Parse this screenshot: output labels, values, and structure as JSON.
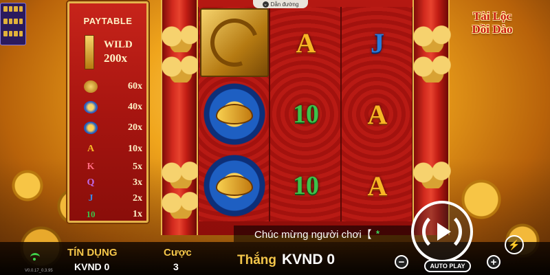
{
  "header": {
    "guide_label": "Dẫn đường"
  },
  "logo": {
    "line1": "Tài Lộc",
    "line2": "Dồi Dào"
  },
  "paytable": {
    "title": "PAYTABLE",
    "wild_label": "WILD",
    "wild_value": "200x",
    "rows": [
      {
        "symbol": "dragon-icon",
        "value": "60x"
      },
      {
        "symbol": "phoenix-icon",
        "value": "40x"
      },
      {
        "symbol": "koi-icon",
        "value": "20x"
      },
      {
        "symbol": "A",
        "value": "10x"
      },
      {
        "symbol": "K",
        "value": "5x"
      },
      {
        "symbol": "Q",
        "value": "3x"
      },
      {
        "symbol": "J",
        "value": "2x"
      },
      {
        "symbol": "10",
        "value": "1x"
      }
    ]
  },
  "reels": [
    [
      "wild-dragon",
      "koi",
      "koi"
    ],
    [
      "A",
      "10",
      "10"
    ],
    [
      "J",
      "A",
      "A"
    ]
  ],
  "marquee": {
    "text": "Chúc mừng người chơi【",
    "star": "*"
  },
  "bottom": {
    "credit_label": "TÍN DỤNG",
    "credit_value": "KVND 0",
    "bet_label": "Cược",
    "bet_value": "3",
    "win_label": "Thắng",
    "win_value": "KVND 0",
    "auto_play_label": "AUTO PLAY",
    "minus_label": "−",
    "plus_label": "+",
    "version": "V0.0.17_0.3.95"
  },
  "colors": {
    "accent_gold": "#f4c64a",
    "frame_red": "#b51812",
    "wifi_green": "#3fd24a"
  }
}
